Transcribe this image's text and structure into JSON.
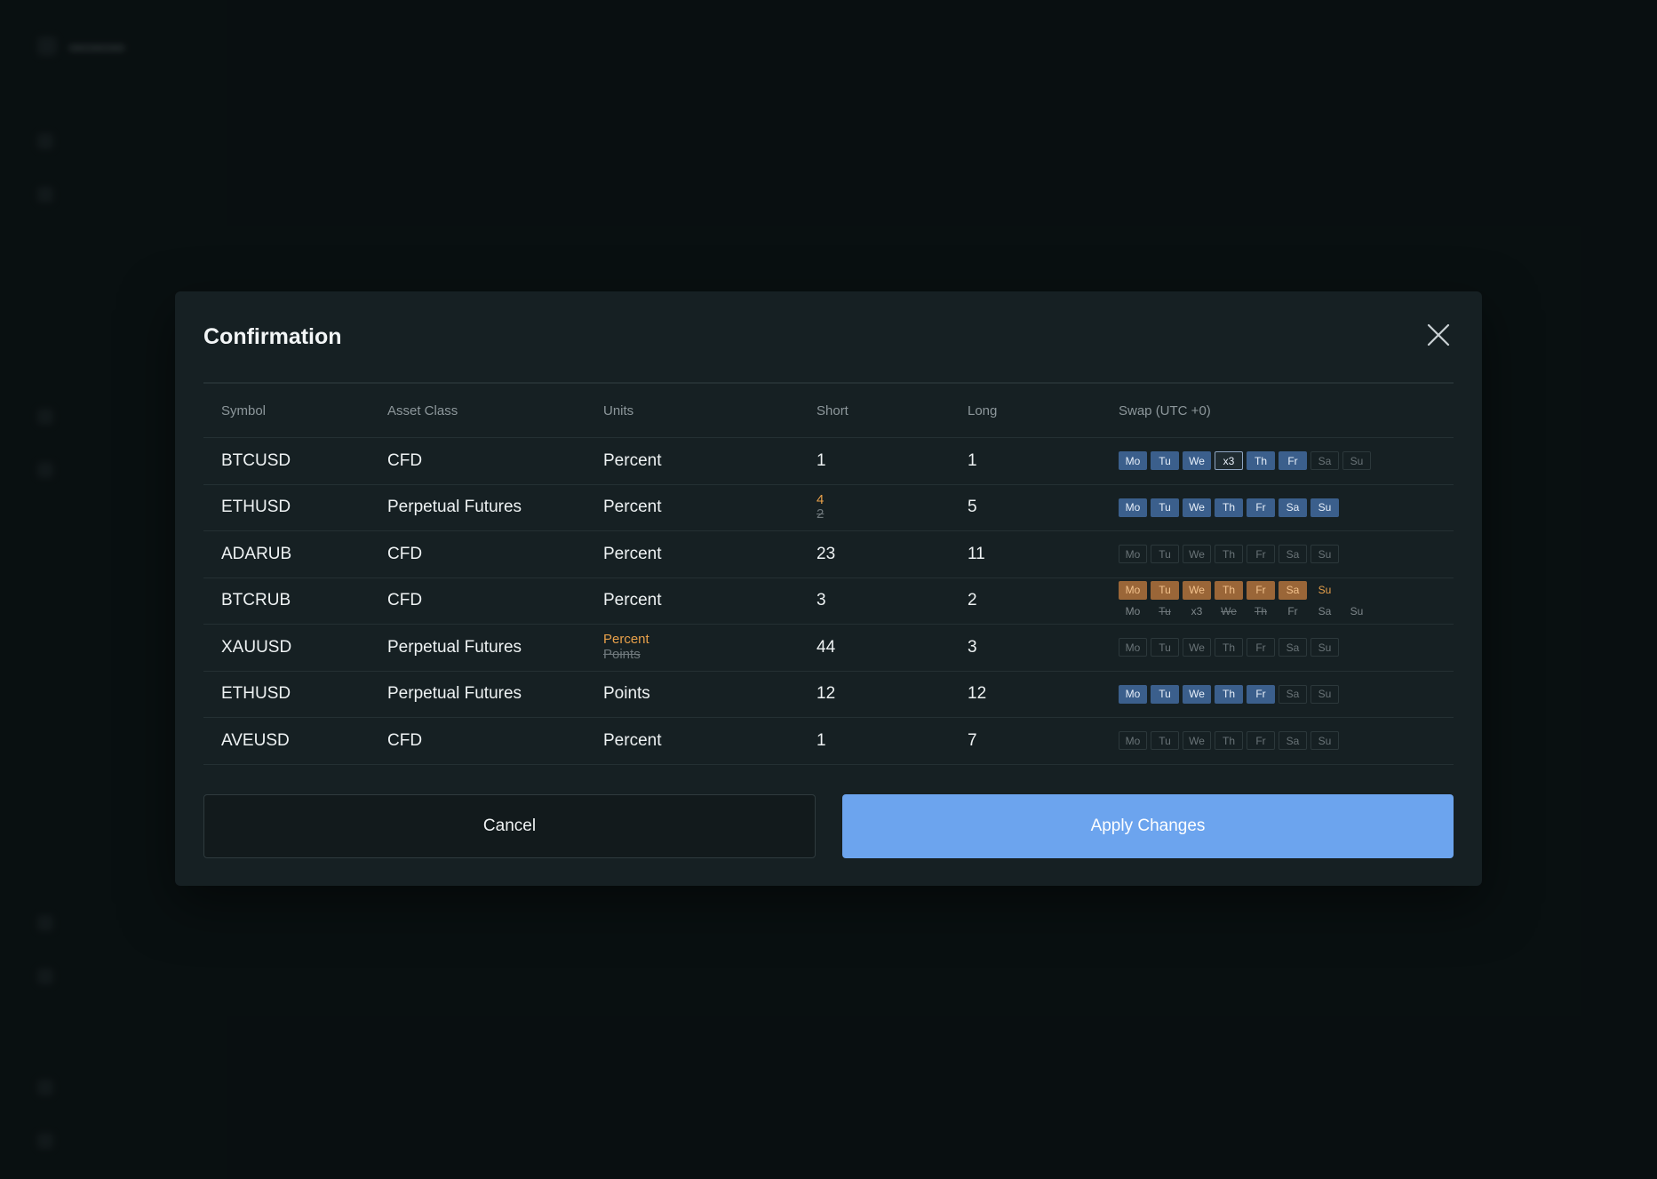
{
  "modal": {
    "title": "Confirmation",
    "cancel_label": "Cancel",
    "apply_label": "Apply Changes"
  },
  "table": {
    "headers": {
      "symbol": "Symbol",
      "asset_class": "Asset Class",
      "units": "Units",
      "short": "Short",
      "long": "Long",
      "swap": "Swap (UTC +0)"
    },
    "rows": [
      {
        "symbol": "BTCUSD",
        "asset_class": "CFD",
        "units": "Percent",
        "units_old": "",
        "short": "1",
        "short_old": "",
        "long": "1",
        "days": [
          {
            "label": "Mo",
            "state": "on"
          },
          {
            "label": "Tu",
            "state": "on"
          },
          {
            "label": "We",
            "state": "on"
          },
          {
            "label": "x3",
            "state": "x3"
          },
          {
            "label": "Th",
            "state": "on"
          },
          {
            "label": "Fr",
            "state": "on"
          },
          {
            "label": "Sa",
            "state": "off"
          },
          {
            "label": "Su",
            "state": "off"
          }
        ],
        "days_old": []
      },
      {
        "symbol": "ETHUSD",
        "asset_class": "Perpetual Futures",
        "units": "Percent",
        "units_old": "",
        "short": "4",
        "short_old": "2",
        "long": "5",
        "days": [
          {
            "label": "Mo",
            "state": "on"
          },
          {
            "label": "Tu",
            "state": "on"
          },
          {
            "label": "We",
            "state": "on"
          },
          {
            "label": "Th",
            "state": "on"
          },
          {
            "label": "Fr",
            "state": "on"
          },
          {
            "label": "Sa",
            "state": "on"
          },
          {
            "label": "Su",
            "state": "on"
          }
        ],
        "days_old": []
      },
      {
        "symbol": "ADARUB",
        "asset_class": "CFD",
        "units": "Percent",
        "units_old": "",
        "short": "23",
        "short_old": "",
        "long": "11",
        "days": [
          {
            "label": "Mo",
            "state": "off"
          },
          {
            "label": "Tu",
            "state": "off"
          },
          {
            "label": "We",
            "state": "off"
          },
          {
            "label": "Th",
            "state": "off"
          },
          {
            "label": "Fr",
            "state": "off"
          },
          {
            "label": "Sa",
            "state": "off"
          },
          {
            "label": "Su",
            "state": "off"
          }
        ],
        "days_old": []
      },
      {
        "symbol": "BTCRUB",
        "asset_class": "CFD",
        "units": "Percent",
        "units_old": "",
        "short": "3",
        "short_old": "",
        "long": "2",
        "days": [
          {
            "label": "Mo",
            "state": "new"
          },
          {
            "label": "Tu",
            "state": "new"
          },
          {
            "label": "We",
            "state": "new"
          },
          {
            "label": "Th",
            "state": "new"
          },
          {
            "label": "Fr",
            "state": "new"
          },
          {
            "label": "Sa",
            "state": "new"
          },
          {
            "label": "Su",
            "state": "newtxt"
          }
        ],
        "days_old": [
          {
            "label": "Mo",
            "state": "plain"
          },
          {
            "label": "Tu",
            "state": "old"
          },
          {
            "label": "x3",
            "state": "plain"
          },
          {
            "label": "We",
            "state": "old"
          },
          {
            "label": "Th",
            "state": "old"
          },
          {
            "label": "Fr",
            "state": "plain"
          },
          {
            "label": "Sa",
            "state": "plain"
          },
          {
            "label": "Su",
            "state": "plain"
          }
        ]
      },
      {
        "symbol": "XAUUSD",
        "asset_class": "Perpetual Futures",
        "units": "Percent",
        "units_old": "Points",
        "short": "44",
        "short_old": "",
        "long": "3",
        "days": [
          {
            "label": "Mo",
            "state": "off"
          },
          {
            "label": "Tu",
            "state": "off"
          },
          {
            "label": "We",
            "state": "off"
          },
          {
            "label": "Th",
            "state": "off"
          },
          {
            "label": "Fr",
            "state": "off"
          },
          {
            "label": "Sa",
            "state": "off"
          },
          {
            "label": "Su",
            "state": "off"
          }
        ],
        "days_old": []
      },
      {
        "symbol": "ETHUSD",
        "asset_class": "Perpetual Futures",
        "units": "Points",
        "units_old": "",
        "short": "12",
        "short_old": "",
        "long": "12",
        "days": [
          {
            "label": "Mo",
            "state": "on"
          },
          {
            "label": "Tu",
            "state": "on"
          },
          {
            "label": "We",
            "state": "on"
          },
          {
            "label": "Th",
            "state": "on"
          },
          {
            "label": "Fr",
            "state": "on"
          },
          {
            "label": "Sa",
            "state": "off"
          },
          {
            "label": "Su",
            "state": "off"
          }
        ],
        "days_old": []
      },
      {
        "symbol": "AVEUSD",
        "asset_class": "CFD",
        "units": "Percent",
        "units_old": "",
        "short": "1",
        "short_old": "",
        "long": "7",
        "days": [
          {
            "label": "Mo",
            "state": "off"
          },
          {
            "label": "Tu",
            "state": "off"
          },
          {
            "label": "We",
            "state": "off"
          },
          {
            "label": "Th",
            "state": "off"
          },
          {
            "label": "Fr",
            "state": "off"
          },
          {
            "label": "Sa",
            "state": "off"
          },
          {
            "label": "Su",
            "state": "off"
          }
        ],
        "days_old": []
      }
    ]
  },
  "colors": {
    "accent": "#6ca4ee",
    "day_active": "#3b5f8c",
    "day_changed": "#9a6638",
    "changed_text": "#e8a04a",
    "modal_bg": "#162023",
    "page_bg": "#0c1416"
  },
  "icons": {
    "close": "close-icon"
  }
}
